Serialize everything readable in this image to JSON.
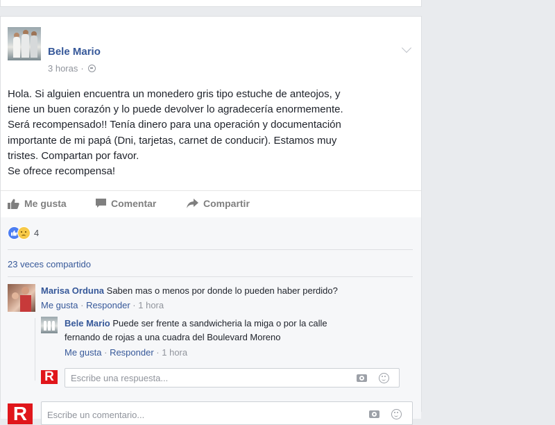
{
  "post": {
    "author": "Bele Mario",
    "time": "3 horas",
    "separator": "·",
    "body_lines": [
      "Hola. Si alguien encuentra un monedero gris tipo estuche de anteojos, y",
      "tiene un buen corazón y lo puede devolver lo agradecería enormemente.",
      "Será recompensado!! Tenía dinero para una operación y documentación",
      "importante de mi papá (Dni, tarjetas, carnet de conducir). Estamos muy",
      "tristes. Compartan por favor.",
      "Se ofrece recompensa!"
    ]
  },
  "actions": {
    "like": "Me gusta",
    "comment": "Comentar",
    "share": "Compartir"
  },
  "reactions": {
    "count": "4"
  },
  "shares": "23 veces compartido",
  "comments": [
    {
      "author": "Marisa Orduna",
      "text": "Saben mas o menos por donde lo pueden haber perdido?",
      "like": "Me gusta",
      "reply": "Responder",
      "time": "1 hora"
    }
  ],
  "reply": {
    "author": "Bele Mario",
    "text_line1": "Puede ser frente a sandwicheria la miga o por la calle",
    "text_line2": "fernando de rojas a una cuadra del Boulevard Moreno",
    "like": "Me gusta",
    "reply": "Responder",
    "time": "1 hora"
  },
  "reply_input": {
    "placeholder": "Escribe una respuesta..."
  },
  "comment_input": {
    "placeholder": "Escribe un comentario..."
  },
  "brand_logo_letter": "R",
  "colors": {
    "link": "#365899",
    "page_bg": "#e9ebee",
    "brand_red": "#e0161b"
  }
}
